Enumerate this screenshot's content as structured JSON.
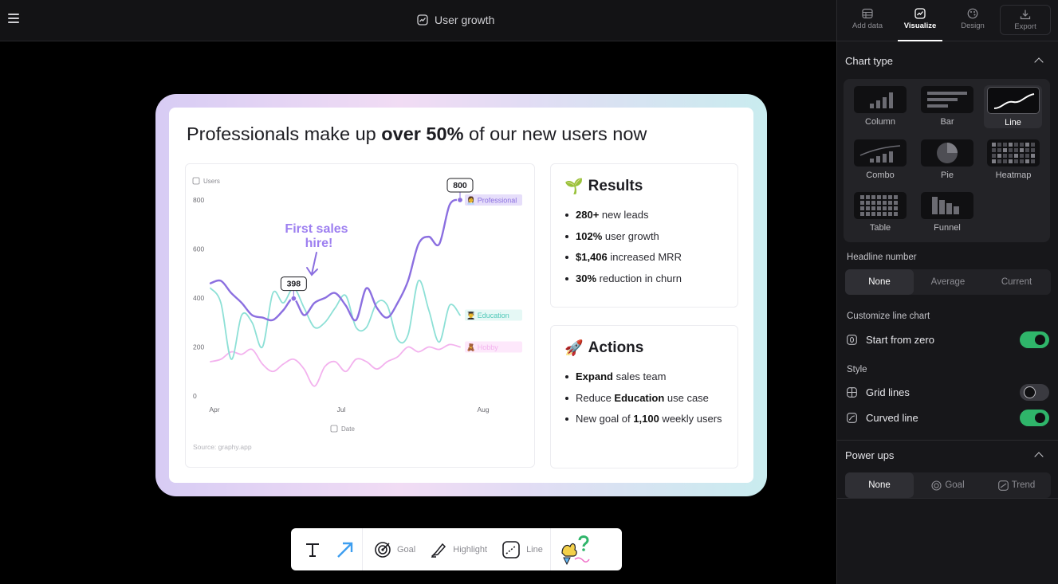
{
  "topbar": {
    "title": "User growth"
  },
  "panel": {
    "tabs": [
      {
        "label": "Add data",
        "icon": "table-icon"
      },
      {
        "label": "Visualize",
        "icon": "chart-icon"
      },
      {
        "label": "Design",
        "icon": "palette-icon"
      },
      {
        "label": "Export",
        "icon": "download-icon"
      }
    ],
    "active_tab": "Visualize",
    "chart_type": {
      "title": "Chart type",
      "options": [
        "Column",
        "Bar",
        "Line",
        "Combo",
        "Pie",
        "Heatmap",
        "Table",
        "Funnel"
      ],
      "selected": "Line"
    },
    "headline_number": {
      "label": "Headline number",
      "options": [
        "None",
        "Average",
        "Current"
      ],
      "selected": "None"
    },
    "customize": {
      "label": "Customize line chart",
      "start_from_zero": {
        "label": "Start from zero",
        "on": true
      }
    },
    "style": {
      "label": "Style",
      "grid_lines": {
        "label": "Grid lines",
        "on": false
      },
      "curved_line": {
        "label": "Curved line",
        "on": true
      }
    },
    "power_ups": {
      "title": "Power ups",
      "options": [
        "None",
        "Goal",
        "Trend"
      ],
      "selected": "None"
    }
  },
  "card": {
    "headline_pre": "Professionals make up ",
    "headline_bold": "over 50%",
    "headline_post": " of our new users now",
    "results": {
      "title": "Results",
      "emoji": "🌱",
      "items": [
        {
          "bold": "280+",
          "text": " new leads"
        },
        {
          "bold": "102%",
          "text": " user growth"
        },
        {
          "bold": "$1,406",
          "text": " increased MRR"
        },
        {
          "bold": "30%",
          "text": " reduction in churn"
        }
      ]
    },
    "actions": {
      "title": "Actions",
      "emoji": "🚀",
      "items": [
        {
          "pre": "",
          "bold": "Expand",
          "post": " sales team"
        },
        {
          "pre": "Reduce ",
          "bold": "Education",
          "post": " use case"
        },
        {
          "pre": "New goal of ",
          "bold": "1,100",
          "post": " weekly users"
        }
      ]
    }
  },
  "chart_data": {
    "type": "line",
    "ylabel": "Users",
    "xlabel": "Date",
    "x_ticks": [
      "Apr",
      "Jul",
      "Aug"
    ],
    "y_ticks": [
      0,
      200,
      400,
      600,
      800
    ],
    "ylim": [
      0,
      800
    ],
    "source": "Source: graphy.app",
    "annotation": "First sales hire!",
    "callouts": [
      {
        "value": 398,
        "series": "Professional"
      },
      {
        "value": 800,
        "series": "Professional"
      }
    ],
    "series": [
      {
        "name": "Professional",
        "emoji": "👩‍💼",
        "color": "#8b6fe0",
        "values": [
          460,
          470,
          420,
          380,
          330,
          320,
          310,
          350,
          398,
          330,
          380,
          400,
          420,
          370,
          310,
          440,
          360,
          320,
          380,
          470,
          620,
          650,
          620,
          780,
          800
        ]
      },
      {
        "name": "Education",
        "emoji": "👨‍🎓",
        "color": "#8de0d6",
        "values": [
          440,
          380,
          150,
          330,
          300,
          200,
          420,
          380,
          440,
          360,
          280,
          300,
          360,
          410,
          280,
          280,
          380,
          370,
          230,
          250,
          470,
          350,
          220,
          370,
          330
        ]
      },
      {
        "name": "Hobby",
        "emoji": "🧸",
        "color": "#f3b2ee",
        "values": [
          140,
          150,
          180,
          170,
          190,
          130,
          100,
          130,
          150,
          110,
          40,
          120,
          140,
          100,
          150,
          140,
          110,
          140,
          160,
          200,
          180,
          200,
          190,
          210,
          200
        ]
      }
    ]
  },
  "toolbar": {
    "items": [
      {
        "label": "",
        "icon": "text-icon"
      },
      {
        "label": "",
        "icon": "arrow-icon"
      },
      {
        "label": "Goal",
        "icon": "target-icon"
      },
      {
        "label": "Highlight",
        "icon": "highlighter-icon"
      },
      {
        "label": "Line",
        "icon": "line-icon"
      },
      {
        "label": "",
        "icon": "sticker-icon"
      }
    ]
  }
}
